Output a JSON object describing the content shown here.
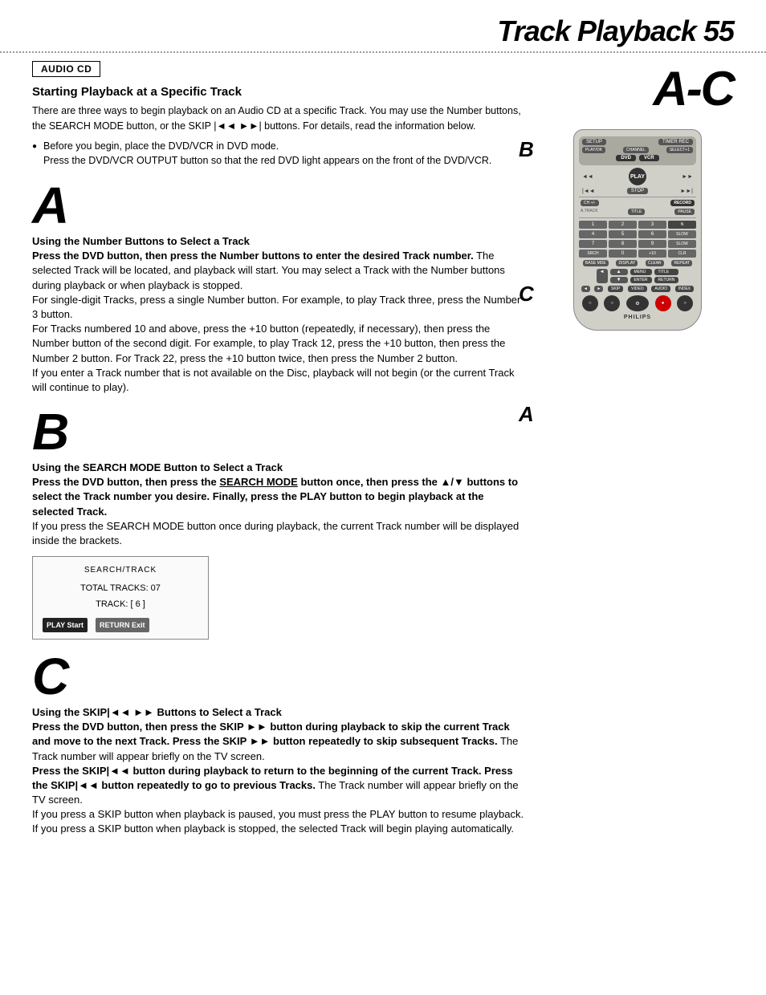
{
  "header": {
    "title": "Track Playback",
    "page_number": "55",
    "dots_line": true
  },
  "audio_cd_badge": "AUDIO CD",
  "section_title": "Starting Playback at a Specific Track",
  "intro_text": "There are three ways to begin playback on an Audio CD at a specific Track. You may use the Number buttons, the SEARCH MODE button, or the SKIP |◄◄ ►►| buttons. For details, read the information below.",
  "bullet_text": "Before you begin, place the DVD/VCR in DVD mode.\nPress the DVD/VCR OUTPUT button so that the red DVD light appears on the front of the DVD/VCR.",
  "section_a": {
    "letter": "A",
    "sub_heading": "Using the Number Buttons to Select a Track",
    "body": "Press the DVD button, then press the Number buttons to enter the desired Track number. The selected Track will be located, and playback will start. You may select a Track with the Number buttons during playback or when playback is stopped.\nFor single-digit Tracks, press a single Number button. For example, to play Track three, press the Number 3 button.\nFor Tracks numbered 10 and above, press the +10 button (repeatedly, if necessary), then press the Number button of the second digit. For example, to play Track 12, press the +10 button, then press the Number 2 button. For Track 22, press the +10 button twice, then press the Number 2 button.\nIf you enter a Track number that is not available on the Disc, playback will not begin (or the current Track will continue to play)."
  },
  "section_b": {
    "letter": "B",
    "sub_heading": "Using the SEARCH MODE Button to Select a Track",
    "body": "Press the DVD button, then press the SEARCH MODE button once, then press the ▲/▼ buttons to select the Track number you desire. Finally, press the PLAY button to begin playback at the selected Track.",
    "note": "If you press the SEARCH MODE button once during playback, the current Track number will be displayed inside the brackets.",
    "display": {
      "title": "SEARCH/TRACK",
      "line1": "TOTAL TRACKS: 07",
      "line2": "TRACK: [ 6 ]",
      "btn1": "PLAY Start",
      "btn2": "RETURN Exit"
    }
  },
  "section_c": {
    "letter": "C",
    "sub_heading": "Using the SKIP|◄◄ ►►| Buttons to Select a Track",
    "body": "Press the DVD button, then press the SKIP ►► button during playback to skip the current Track and move to the next Track. Press the SKIP ►► button repeatedly to skip subsequent Tracks. The Track number will appear briefly on the TV screen.\nPress the SKIP|◄◄ button during playback to return to the beginning of the current Track. Press the SKIP|◄◄ button repeatedly to go to previous Tracks. The Track number will appear briefly on the TV screen.\nIf you press a SKIP button when playback is paused, you must press the PLAY button to resume playback.\nIf you press a SKIP button when playback is stopped, the selected Track will begin playing automatically."
  },
  "right_column": {
    "ac_label": "A-C",
    "side_b_label": "B",
    "side_c_label": "C",
    "side_a_label": "A",
    "remote_brand": "PHILIPS"
  }
}
